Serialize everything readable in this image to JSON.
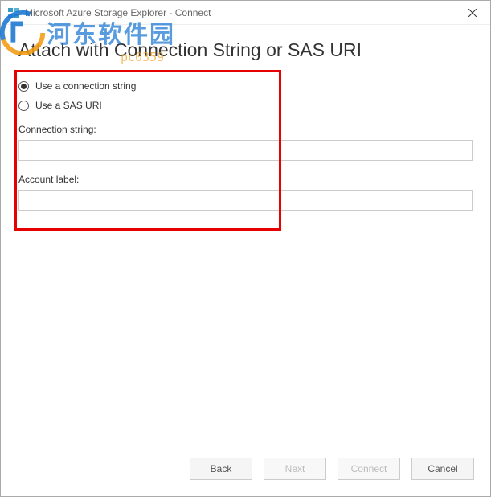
{
  "window": {
    "title": "Microsoft Azure Storage Explorer - Connect"
  },
  "page": {
    "heading": "Attach with Connection String or SAS URI"
  },
  "options": {
    "use_connection_string": {
      "label": "Use a connection string",
      "checked": true
    },
    "use_sas_uri": {
      "label": "Use a SAS URI",
      "checked": false
    }
  },
  "fields": {
    "connection_string": {
      "label": "Connection string:",
      "value": ""
    },
    "account_label": {
      "label": "Account label:",
      "value": ""
    }
  },
  "buttons": {
    "back": "Back",
    "next": "Next",
    "connect": "Connect",
    "cancel": "Cancel"
  },
  "watermark": {
    "text": "河东软件园",
    "sub": "pc0359"
  }
}
